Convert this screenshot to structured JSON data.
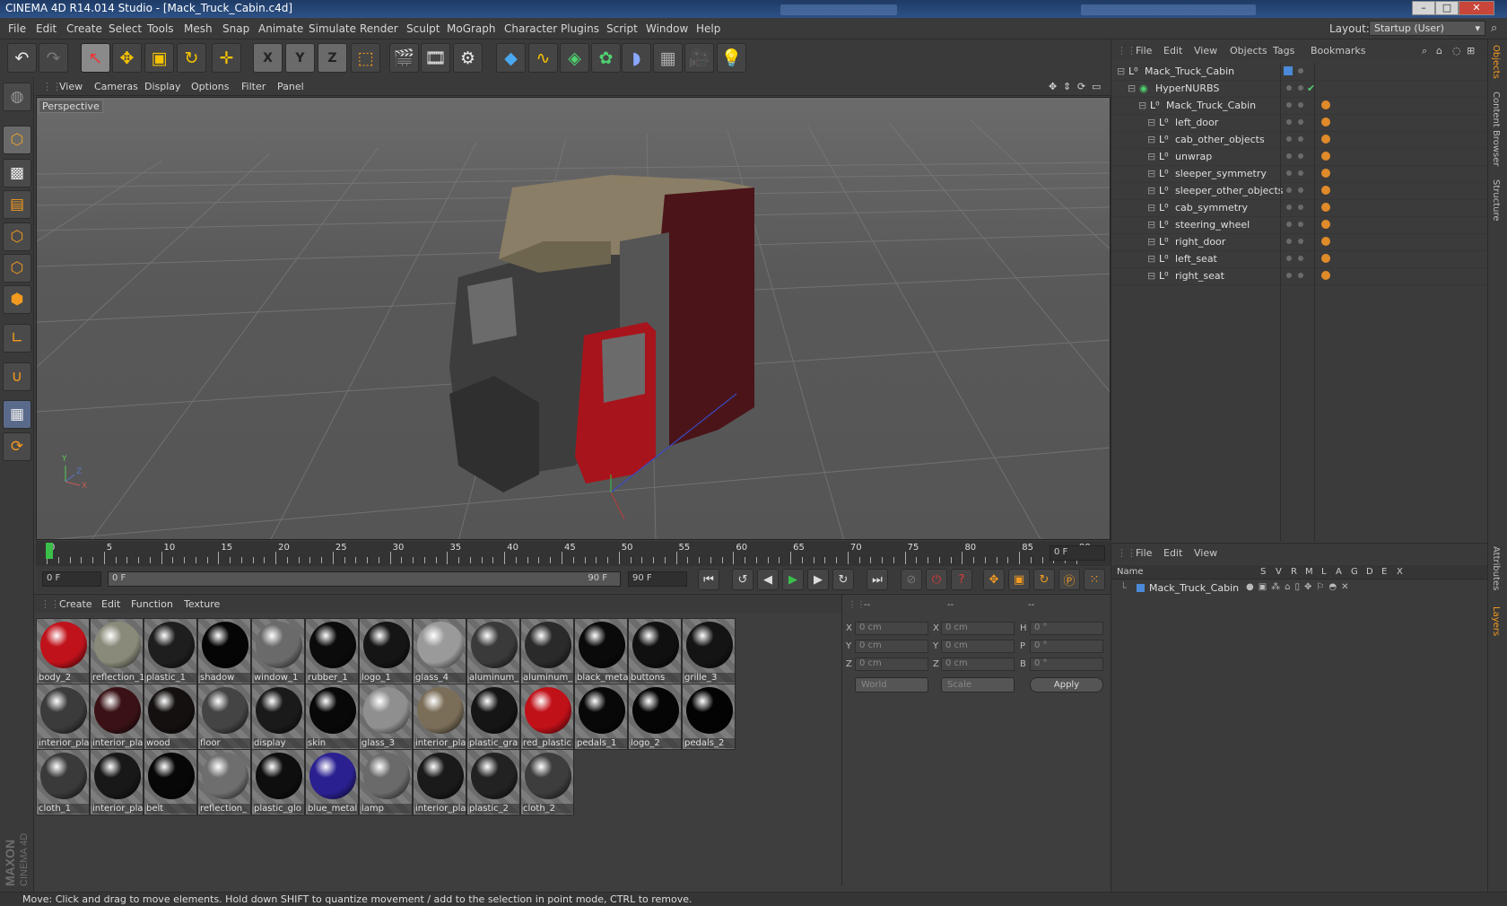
{
  "window": {
    "title": "CINEMA 4D R14.014 Studio - [Mack_Truck_Cabin.c4d]",
    "minimize": "–",
    "maximize": "□",
    "close": "✕"
  },
  "menubar": {
    "items": [
      "File",
      "Edit",
      "Create",
      "Select",
      "Tools",
      "Mesh",
      "Snap",
      "Animate",
      "Simulate",
      "Render",
      "Sculpt",
      "MoGraph",
      "Character",
      "Plugins",
      "Script",
      "Window",
      "Help"
    ],
    "layout_label": "Layout:",
    "layout_value": "Startup (User)"
  },
  "toolbar": {
    "icons": [
      "undo-icon",
      "redo-icon",
      "live-selection-icon",
      "move-icon",
      "scale-icon",
      "rotate-icon",
      "recent-tool-icon",
      "x-axis-icon",
      "y-axis-icon",
      "z-axis-icon",
      "coordinate-system-icon",
      "render-view-icon",
      "render-picture-viewer-icon",
      "edit-render-settings-icon",
      "cube-primitive-icon",
      "spline-icon",
      "nurbs-icon",
      "array-icon",
      "deformer-icon",
      "floor-scene-icon",
      "camera-icon",
      "light-icon"
    ],
    "axis_labels": [
      "X",
      "Y",
      "Z"
    ]
  },
  "left_toolbar": {
    "icons": [
      "make-editable-icon",
      "model-mode-icon",
      "texture-mode-icon",
      "workplane-mode-icon",
      "points-mode-icon",
      "edges-mode-icon",
      "polygons-mode-icon",
      "axis-mode-icon",
      "snap-magnet-icon",
      "workplane-grid-icon",
      "soft-selection-icon"
    ]
  },
  "viewport": {
    "menu": [
      "View",
      "Cameras",
      "Display",
      "Options",
      "Filter",
      "Panel"
    ],
    "label": "Perspective",
    "axis": {
      "x": "X",
      "y": "Y",
      "z": "Z"
    }
  },
  "timeline": {
    "ticks": [
      "0",
      "5",
      "10",
      "15",
      "20",
      "25",
      "30",
      "35",
      "40",
      "45",
      "50",
      "55",
      "60",
      "65",
      "70",
      "75",
      "80",
      "85",
      "90"
    ],
    "current_frame": "0 F"
  },
  "playbar": {
    "start_field": "0 F",
    "range_start": "0 F",
    "range_end": "90 F",
    "end_field": "90 F"
  },
  "materials": {
    "menu": [
      "Create",
      "Edit",
      "Function",
      "Texture"
    ],
    "items": [
      {
        "name": "body_2",
        "color": "#c0121b"
      },
      {
        "name": "reflection_1",
        "color": "#8a8a7a"
      },
      {
        "name": "plastic_1",
        "color": "#1e1e1e"
      },
      {
        "name": "shadow",
        "color": "#050505"
      },
      {
        "name": "window_1",
        "color": "#6a6a6a"
      },
      {
        "name": "rubber_1",
        "color": "#0b0b0b"
      },
      {
        "name": "logo_1",
        "color": "#151515"
      },
      {
        "name": "glass_4",
        "color": "#9a9a9a"
      },
      {
        "name": "aluminum_",
        "color": "#3a3a3a"
      },
      {
        "name": "aluminum_",
        "color": "#2a2a2a"
      },
      {
        "name": "black_meta",
        "color": "#0a0a0a"
      },
      {
        "name": "buttons",
        "color": "#101010"
      },
      {
        "name": "grille_3",
        "color": "#141414"
      },
      {
        "name": "interior_pla",
        "color": "#3b3b3b"
      },
      {
        "name": "interior_pla",
        "color": "#3a1216"
      },
      {
        "name": "wood",
        "color": "#151010"
      },
      {
        "name": "floor",
        "color": "#444444"
      },
      {
        "name": "display",
        "color": "#1a1a1a"
      },
      {
        "name": "skin",
        "color": "#080808"
      },
      {
        "name": "glass_3",
        "color": "#8f8f8f"
      },
      {
        "name": "interior_pla",
        "color": "#7b6e58"
      },
      {
        "name": "plastic_gra",
        "color": "#151515"
      },
      {
        "name": "red_plastic",
        "color": "#c01018"
      },
      {
        "name": "pedals_1",
        "color": "#080808"
      },
      {
        "name": "logo_2",
        "color": "#050505"
      },
      {
        "name": "pedals_2",
        "color": "#030303"
      },
      {
        "name": "cloth_1",
        "color": "#3a3a3a"
      },
      {
        "name": "interior_pla",
        "color": "#181818"
      },
      {
        "name": "belt",
        "color": "#070707"
      },
      {
        "name": "reflection_",
        "color": "#6e6e6e"
      },
      {
        "name": "plastic_glo",
        "color": "#0e0e0e"
      },
      {
        "name": "blue_metal",
        "color": "#2a2090"
      },
      {
        "name": "lamp",
        "color": "#6a6a6a"
      },
      {
        "name": "interior_pla",
        "color": "#1a1a1a"
      },
      {
        "name": "plastic_2",
        "color": "#222222"
      },
      {
        "name": "cloth_2",
        "color": "#3d3d3d"
      }
    ]
  },
  "coordinates": {
    "header": [
      "--",
      "--",
      "--"
    ],
    "rows": [
      {
        "a": "X",
        "av": "0 cm",
        "b": "X",
        "bv": "0 cm",
        "c": "H",
        "cv": "0 °"
      },
      {
        "a": "Y",
        "av": "0 cm",
        "b": "Y",
        "bv": "0 cm",
        "c": "P",
        "cv": "0 °"
      },
      {
        "a": "Z",
        "av": "0 cm",
        "b": "Z",
        "bv": "0 cm",
        "c": "B",
        "cv": "0 °"
      }
    ],
    "world": "World",
    "scale": "Scale",
    "apply": "Apply"
  },
  "objects": {
    "menu": [
      "File",
      "Edit",
      "View",
      "Objects",
      "Tags",
      "Bookmarks"
    ],
    "tree": [
      {
        "name": "Mack_Truck_Cabin",
        "depth": 0,
        "tag": "layer"
      },
      {
        "name": "HyperNURBS",
        "depth": 1,
        "tag": "check"
      },
      {
        "name": "Mack_Truck_Cabin",
        "depth": 2,
        "tag": "material"
      },
      {
        "name": "left_door",
        "depth": 3,
        "tag": "material"
      },
      {
        "name": "cab_other_objects",
        "depth": 3,
        "tag": "material"
      },
      {
        "name": "unwrap",
        "depth": 3,
        "tag": "material"
      },
      {
        "name": "sleeper_symmetry",
        "depth": 3,
        "tag": "material"
      },
      {
        "name": "sleeper_other_objects",
        "depth": 3,
        "tag": "material"
      },
      {
        "name": "cab_symmetry",
        "depth": 3,
        "tag": "material"
      },
      {
        "name": "steering_wheel",
        "depth": 3,
        "tag": "material"
      },
      {
        "name": "right_door",
        "depth": 3,
        "tag": "material"
      },
      {
        "name": "left_seat",
        "depth": 3,
        "tag": "material"
      },
      {
        "name": "right_seat",
        "depth": 3,
        "tag": "material"
      }
    ]
  },
  "layers": {
    "menu": [
      "File",
      "Edit",
      "View"
    ],
    "columns": [
      "Name",
      "S",
      "V",
      "R",
      "M",
      "L",
      "A",
      "G",
      "D",
      "E",
      "X"
    ],
    "rows": [
      "Mack_Truck_Cabin"
    ]
  },
  "side_tabs": [
    "Objects",
    "Content Browser",
    "Structure",
    "Attributes",
    "Layers"
  ],
  "statusbar": {
    "text": "Move: Click and drag to move elements. Hold down SHIFT to quantize movement / add to the selection in point mode, CTRL to remove."
  },
  "brand": {
    "line1": "MAXON",
    "line2": "CINEMA 4D"
  }
}
